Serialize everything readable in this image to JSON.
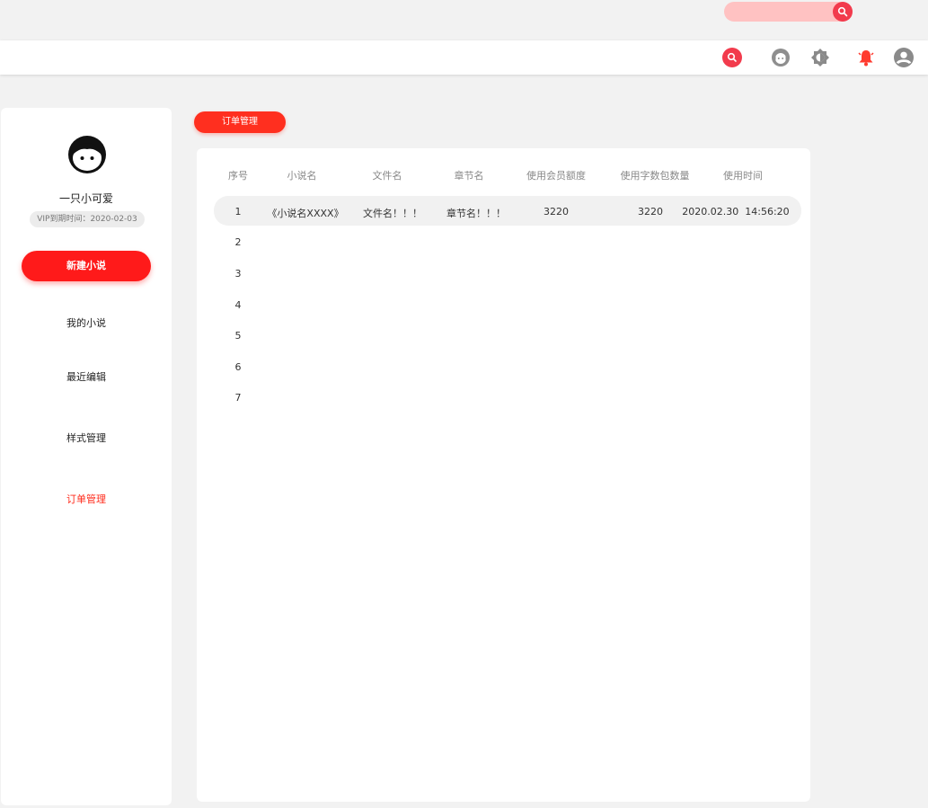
{
  "topbar": {
    "search_icon": "search-icon"
  },
  "header": {
    "icons": [
      "search-icon",
      "support-icon",
      "theme-icon",
      "bell-icon",
      "account-icon"
    ]
  },
  "sidebar": {
    "username": "一只小可爱",
    "vip": "VIP到期时间：2020-02-03",
    "new_button": "新建小说",
    "items": [
      {
        "label": "我的小说"
      },
      {
        "label": "最近编辑"
      },
      {
        "label": "样式管理"
      },
      {
        "label": "订单管理",
        "active": true
      }
    ]
  },
  "page": {
    "title": "订单管理"
  },
  "table": {
    "headers": [
      "序号",
      "小说名",
      "文件名",
      "章节名",
      "使用会员额度",
      "使用字数包数量",
      "使用时间"
    ],
    "rows": [
      [
        "1",
        "《小说名XXXX》",
        "文件名！！！",
        "章节名！！！",
        "3220",
        "3220",
        "2020.02.30  14:56:20"
      ],
      [
        "2",
        "",
        "",
        "",
        "",
        "",
        ""
      ],
      [
        "3",
        "",
        "",
        "",
        "",
        "",
        ""
      ],
      [
        "4",
        "",
        "",
        "",
        "",
        "",
        ""
      ],
      [
        "5",
        "",
        "",
        "",
        "",
        "",
        ""
      ],
      [
        "6",
        "",
        "",
        "",
        "",
        "",
        ""
      ],
      [
        "7",
        "",
        "",
        "",
        "",
        "",
        ""
      ]
    ]
  },
  "colors": {
    "accent": "#ff1a1a",
    "pill": "#ff2f1f",
    "search_bg": "#ffc2c2",
    "bell": "#ff3b2f"
  }
}
